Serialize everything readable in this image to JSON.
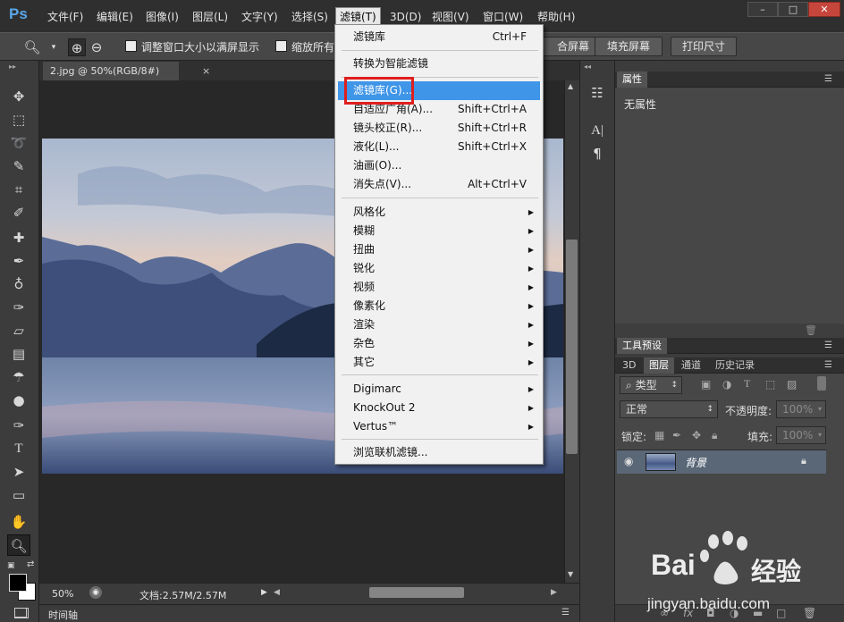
{
  "menubar": {
    "logo": "Ps",
    "items": [
      "文件(F)",
      "编辑(E)",
      "图像(I)",
      "图层(L)",
      "文字(Y)",
      "选择(S)",
      "滤镜(T)",
      "3D(D)",
      "视图(V)",
      "窗口(W)",
      "帮助(H)"
    ],
    "active_item": "滤镜(T)"
  },
  "options": {
    "fit_window_label": "调整窗口大小以满屏显示",
    "zoom_all_label": "缩放所有",
    "fit_screen_button": "合屏幕",
    "fill_screen_button": "填充屏幕",
    "print_size_button": "打印尺寸"
  },
  "document": {
    "tab_title": "2.jpg @ 50%(RGB/8#)",
    "tab_close": "×"
  },
  "status": {
    "zoom": "50%",
    "doc_info": "文档:2.57M/2.57M",
    "timeline_label": "时间轴"
  },
  "properties_panel": {
    "tab": "属性",
    "content": "无属性"
  },
  "tool_presets_panel": {
    "tab": "工具预设"
  },
  "layers_panel": {
    "tabs": [
      "3D",
      "图层",
      "通道",
      "历史记录"
    ],
    "active_tab": "图层",
    "filter_kind": "类型",
    "blend_mode": "正常",
    "opacity_label": "不透明度:",
    "opacity_value": "100%",
    "lock_label": "锁定:",
    "fill_label": "填充:",
    "fill_value": "100%",
    "layer_name": "背景"
  },
  "filter_menu": {
    "group1": [
      {
        "label": "滤镜库",
        "shortcut": "Ctrl+F"
      }
    ],
    "group2": [
      {
        "label": "转换为智能滤镜",
        "shortcut": ""
      }
    ],
    "group3": [
      {
        "label": "滤镜库(G)...",
        "shortcut": "",
        "highlighted": true
      },
      {
        "label": "自适应广角(A)...",
        "shortcut": "Shift+Ctrl+A"
      },
      {
        "label": "镜头校正(R)...",
        "shortcut": "Shift+Ctrl+R"
      },
      {
        "label": "液化(L)...",
        "shortcut": "Shift+Ctrl+X"
      },
      {
        "label": "油画(O)...",
        "shortcut": ""
      },
      {
        "label": "消失点(V)...",
        "shortcut": "Alt+Ctrl+V"
      }
    ],
    "group4": [
      "风格化",
      "模糊",
      "扭曲",
      "锐化",
      "视频",
      "像素化",
      "渲染",
      "杂色",
      "其它"
    ],
    "group5": [
      "Digimarc",
      "KnockOut 2",
      "Vertus™"
    ],
    "group6": [
      {
        "label": "浏览联机滤镜...",
        "shortcut": ""
      }
    ]
  },
  "watermark": {
    "brand": "Bai",
    "brand_cn": "经验",
    "url": "jingyan.baidu.com"
  },
  "colors": {
    "highlight": "#3f95e8",
    "annotation_box": "#e01e1e",
    "logo_blue": "#5aa7ea"
  }
}
